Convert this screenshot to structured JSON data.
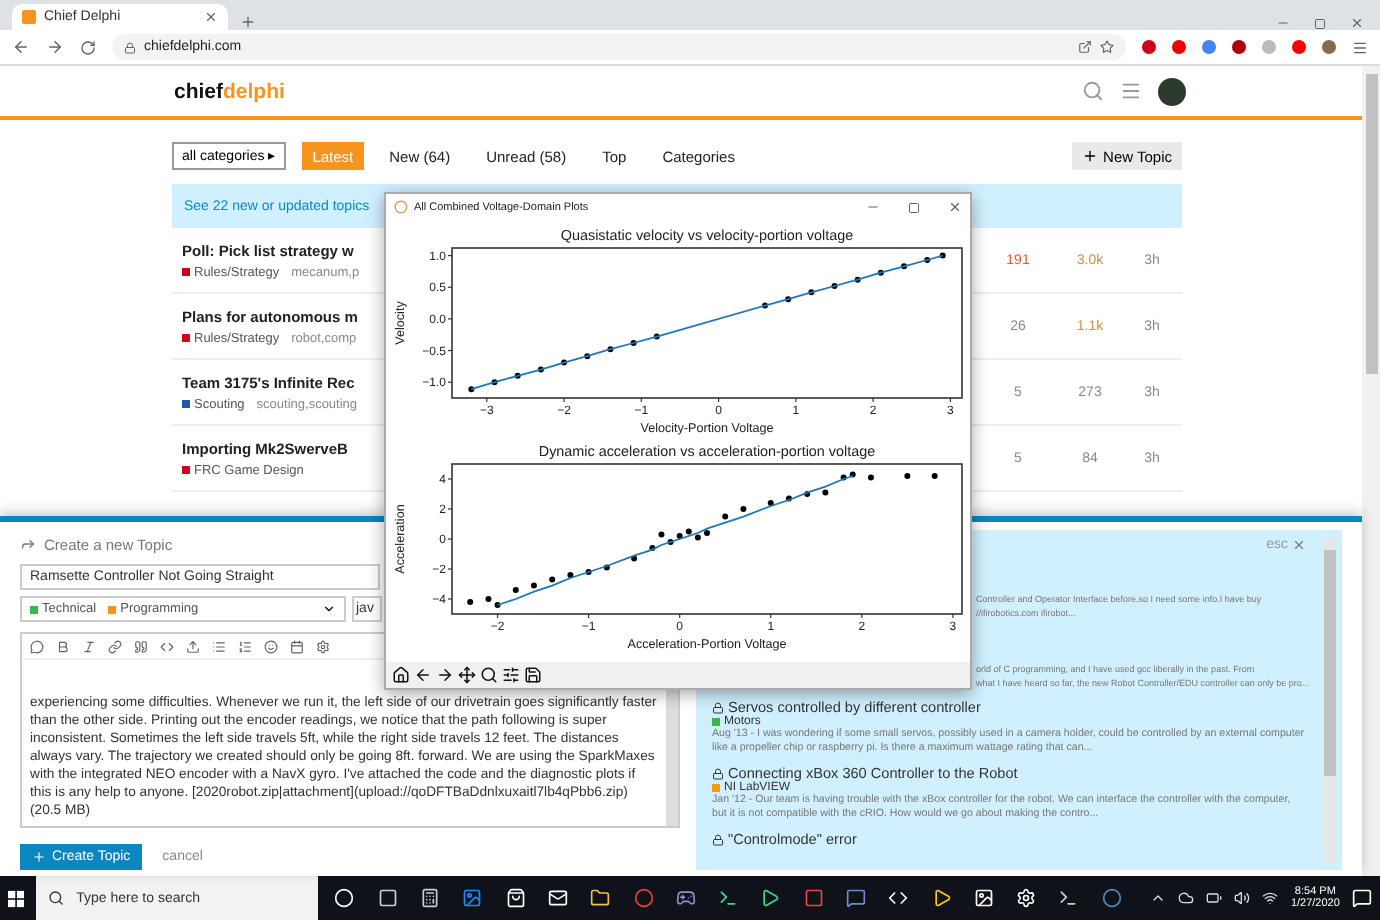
{
  "browser": {
    "tab_title": "Chief Delphi",
    "url": "chiefdelphi.com"
  },
  "site": {
    "logo_first": "chief",
    "logo_second": "delphi"
  },
  "nav": {
    "category_filter": "all categories",
    "category_caret": "▸",
    "tabs": [
      {
        "label": "Latest",
        "selected": true
      },
      {
        "label": "New (64)",
        "selected": false
      },
      {
        "label": "Unread (58)",
        "selected": false
      },
      {
        "label": "Top",
        "selected": false
      },
      {
        "label": "Categories",
        "selected": false
      }
    ],
    "new_topic": "New Topic"
  },
  "banner": "See 22 new or updated topics",
  "topics": [
    {
      "title": "Poll: Pick list strategy w",
      "category": "Rules/Strategy",
      "color": "#d0021b",
      "tags": "mecanum,p",
      "replies": "191",
      "views": "3.0k",
      "activity": "3h"
    },
    {
      "title": "Plans for autonomous m",
      "category": "Rules/Strategy",
      "color": "#d0021b",
      "tags": "robot,comp",
      "replies": "26",
      "views": "1.1k",
      "activity": "3h"
    },
    {
      "title": "Team 3175's Infinite Rec",
      "category": "Scouting",
      "color": "#1f5aa8",
      "tags": "scouting,scouting",
      "replies": "5",
      "views": "273",
      "activity": "3h"
    },
    {
      "title": "Importing Mk2SwerveB",
      "category": "FRC Game Design",
      "color": "#d0021b",
      "replies": "5",
      "views": "84",
      "activity": "3h"
    }
  ],
  "composer": {
    "heading": "Create a new Topic",
    "title_value": "Ramsette Controller Not Going Straight",
    "categories": [
      {
        "name": "Technical",
        "color": "#3ab54a"
      },
      {
        "name": "Programming",
        "color": "#f7941d"
      }
    ],
    "tags_value": "jav",
    "body": "experiencing some difficulties. Whenever we run it, the left side of our drivetrain goes significantly faster than the other side. Printing out the encoder readings, we notice that the path following is super inconsistent. Sometimes the left side travels 5ft, while the right side travels 12 feet. The distances always vary. The trajectory we created should only be going 8ft. forward. We are using the SparkMaxes with the integrated NEO encoder with a NavX gyro. I've attached the code and the diagnostic plots if this is any help to anyone. [2020robot.zip|attachment](upload://qoDFTBaDdnlxuxaitl7lb4qPbb6.zip) (20.5 MB)",
    "submit": "Create Topic",
    "cancel": "cancel"
  },
  "similar": {
    "close_hint": "esc",
    "results": [
      {
        "kind": "partial",
        "lines": [
          "Controller and Operator Interface before.so I need some info.I have buy",
          "//ifirobotics.com ifirobot..."
        ]
      },
      {
        "kind": "partial",
        "lines": [
          "orld of C programming, and I have used gcc liberally in the past. From",
          "what I have heard so far, the new Robot Controller/EDU controller can only be pro..."
        ]
      },
      {
        "kind": "full",
        "title": "Servos controlled by different controller",
        "category": "Motors",
        "color": "#3ab54a",
        "excerpt": "Aug '13 - I was wondering if some small servos, possibly used in a camera holder, could be controlled by an external computer like a propeller chip or raspberry pi. Is there a maximum wattage rating that can..."
      },
      {
        "kind": "full",
        "title": "Connecting xBox 360 Controller to the Robot",
        "category": "NI LabVIEW",
        "color": "#f39c12",
        "excerpt": "Jan '12 - Our team is having trouble with the xBox controller for the robot. We can interface the controller with the computer, but it is not compatible with the cRIO. How would we go about making the contro..."
      },
      {
        "kind": "title",
        "title": "\"Controlmode\" error"
      }
    ]
  },
  "plot_window": {
    "title": "All Combined Voltage-Domain Plots",
    "charts": [
      {
        "chart_data": {
          "type": "scatter",
          "title": "Quasistatic velocity vs velocity-portion voltage",
          "xlabel": "Velocity-Portion Voltage",
          "ylabel": "Velocity",
          "x": [
            -3.2,
            -2.9,
            -2.6,
            -2.3,
            -2.0,
            -1.7,
            -1.4,
            -1.1,
            -0.8,
            0.6,
            0.9,
            1.2,
            1.5,
            1.8,
            2.1,
            2.4,
            2.7,
            2.9
          ],
          "series": [
            {
              "color": "#000000",
              "values": [
                -1.11,
                -1.0,
                -0.9,
                -0.8,
                -0.69,
                -0.59,
                -0.48,
                -0.38,
                -0.28,
                0.21,
                0.31,
                0.42,
                0.52,
                0.62,
                0.73,
                0.83,
                0.93,
                1.0
              ]
            },
            {
              "type": "line",
              "color": "#1f77b4",
              "values": [
                -1.11,
                -1.0,
                -0.9,
                -0.8,
                -0.69,
                -0.59,
                -0.48,
                -0.38,
                -0.28,
                0.21,
                0.31,
                0.42,
                0.52,
                0.62,
                0.73,
                0.83,
                0.93,
                1.0
              ]
            }
          ],
          "xlim": [
            -3.45,
            3.15
          ],
          "ylim": [
            -1.25,
            1.12
          ],
          "xticks": [
            {
              "value": -3,
              "label": "−3"
            },
            {
              "value": -2,
              "label": "−2"
            },
            {
              "value": -1,
              "label": "−1"
            },
            {
              "value": 0,
              "label": "0"
            },
            {
              "value": 1,
              "label": "1"
            },
            {
              "value": 2,
              "label": "2"
            },
            {
              "value": 3,
              "label": "3"
            }
          ],
          "yticks": [
            {
              "value": 1,
              "label": "1.0"
            },
            {
              "value": 0.5,
              "label": "0.5"
            },
            {
              "value": 0,
              "label": "0.0"
            },
            {
              "value": -0.5,
              "label": "−0.5"
            },
            {
              "value": -1,
              "label": "−1.0"
            }
          ]
        }
      },
      {
        "chart_data": {
          "type": "scatter",
          "title": "Dynamic acceleration vs acceleration-portion voltage",
          "xlabel": "Acceleration-Portion Voltage",
          "ylabel": "Acceleration",
          "x": [
            -2.3,
            -2.1,
            -2.0,
            -1.8,
            -1.6,
            -1.4,
            -1.2,
            -1.0,
            -0.8,
            -0.5,
            -0.3,
            -0.2,
            -0.1,
            0,
            0.1,
            0.2,
            0.3,
            0.5,
            0.7,
            1.0,
            1.2,
            1.4,
            1.6,
            1.8,
            1.9,
            2.1,
            2.5,
            2.8
          ],
          "series": [
            {
              "color": "#000000",
              "values": [
                -4.2,
                -4.0,
                -4.4,
                -3.4,
                -3.1,
                -2.7,
                -2.4,
                -2.2,
                -1.9,
                -1.3,
                -0.6,
                0.3,
                -0.2,
                0.2,
                0.5,
                0.1,
                0.4,
                1.5,
                2.0,
                2.4,
                2.7,
                3.0,
                3.1,
                4.1,
                4.3,
                4.1,
                4.2,
                4.2
              ]
            },
            {
              "type": "line",
              "color": "#1f77b4",
              "values": [
                null,
                null,
                -4.4,
                -4.0,
                -3.5,
                -3.1,
                -2.6,
                -2.2,
                -1.8,
                -1.1,
                -0.7,
                -0.4,
                -0.2,
                0,
                0.2,
                0.4,
                0.7,
                1.1,
                1.5,
                2.2,
                2.6,
                3.1,
                3.5,
                4.0,
                4.2,
                null,
                null,
                null
              ]
            }
          ],
          "xlim": [
            -2.5,
            3.1
          ],
          "ylim": [
            -5,
            5
          ],
          "xticks": [
            {
              "value": -2,
              "label": "−2"
            },
            {
              "value": -1,
              "label": "−1"
            },
            {
              "value": 0,
              "label": "0"
            },
            {
              "value": 1,
              "label": "1"
            },
            {
              "value": 2,
              "label": "2"
            },
            {
              "value": 3,
              "label": "3"
            }
          ],
          "yticks": [
            {
              "value": 4,
              "label": "4"
            },
            {
              "value": 2,
              "label": "2"
            },
            {
              "value": 0,
              "label": "0"
            },
            {
              "value": -2,
              "label": "−2"
            },
            {
              "value": -4,
              "label": "−4"
            }
          ]
        }
      }
    ]
  },
  "taskbar": {
    "search_placeholder": "Type here to search",
    "time": "8:54 PM",
    "date": "1/27/2020"
  }
}
